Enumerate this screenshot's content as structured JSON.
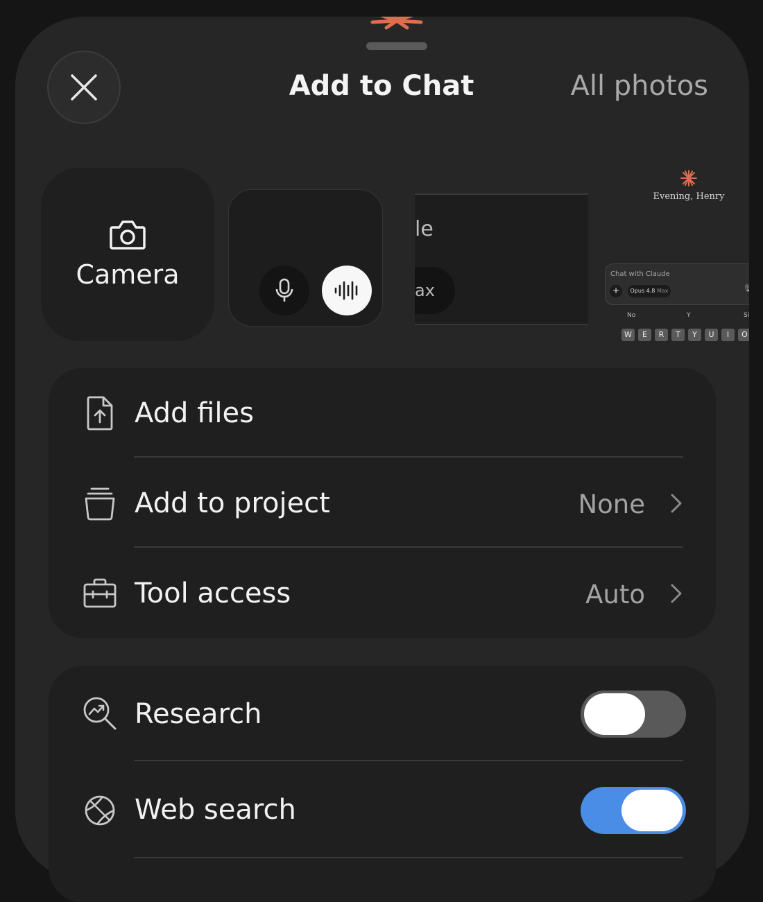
{
  "header": {
    "title": "Add to Chat",
    "all_photos_label": "All photos"
  },
  "quick_actions": {
    "camera_label": "Camera"
  },
  "thumbnails": {
    "partial_text_top": "le",
    "partial_text_pill": "ax",
    "claude_preview": {
      "greeting": "Evening, Henry",
      "input_placeholder": "Chat with Claude",
      "model_name": "Opus 4.8",
      "model_tier": "Max",
      "suggestions": [
        "No",
        "Y",
        "Si"
      ],
      "keys": [
        "W",
        "E",
        "R",
        "T",
        "Y",
        "U",
        "I",
        "O"
      ]
    }
  },
  "menu": {
    "add_files": {
      "label": "Add files"
    },
    "add_to_project": {
      "label": "Add to project",
      "value": "None"
    },
    "tool_access": {
      "label": "Tool access",
      "value": "Auto"
    }
  },
  "toggles": {
    "research": {
      "label": "Research",
      "enabled": false
    },
    "web_search": {
      "label": "Web search",
      "enabled": true
    }
  },
  "colors": {
    "accent_orange": "#d9704f",
    "toggle_on": "#4a8de6",
    "toggle_off": "#595959",
    "sheet_bg": "#262626",
    "card_bg": "#1f1f1f"
  }
}
